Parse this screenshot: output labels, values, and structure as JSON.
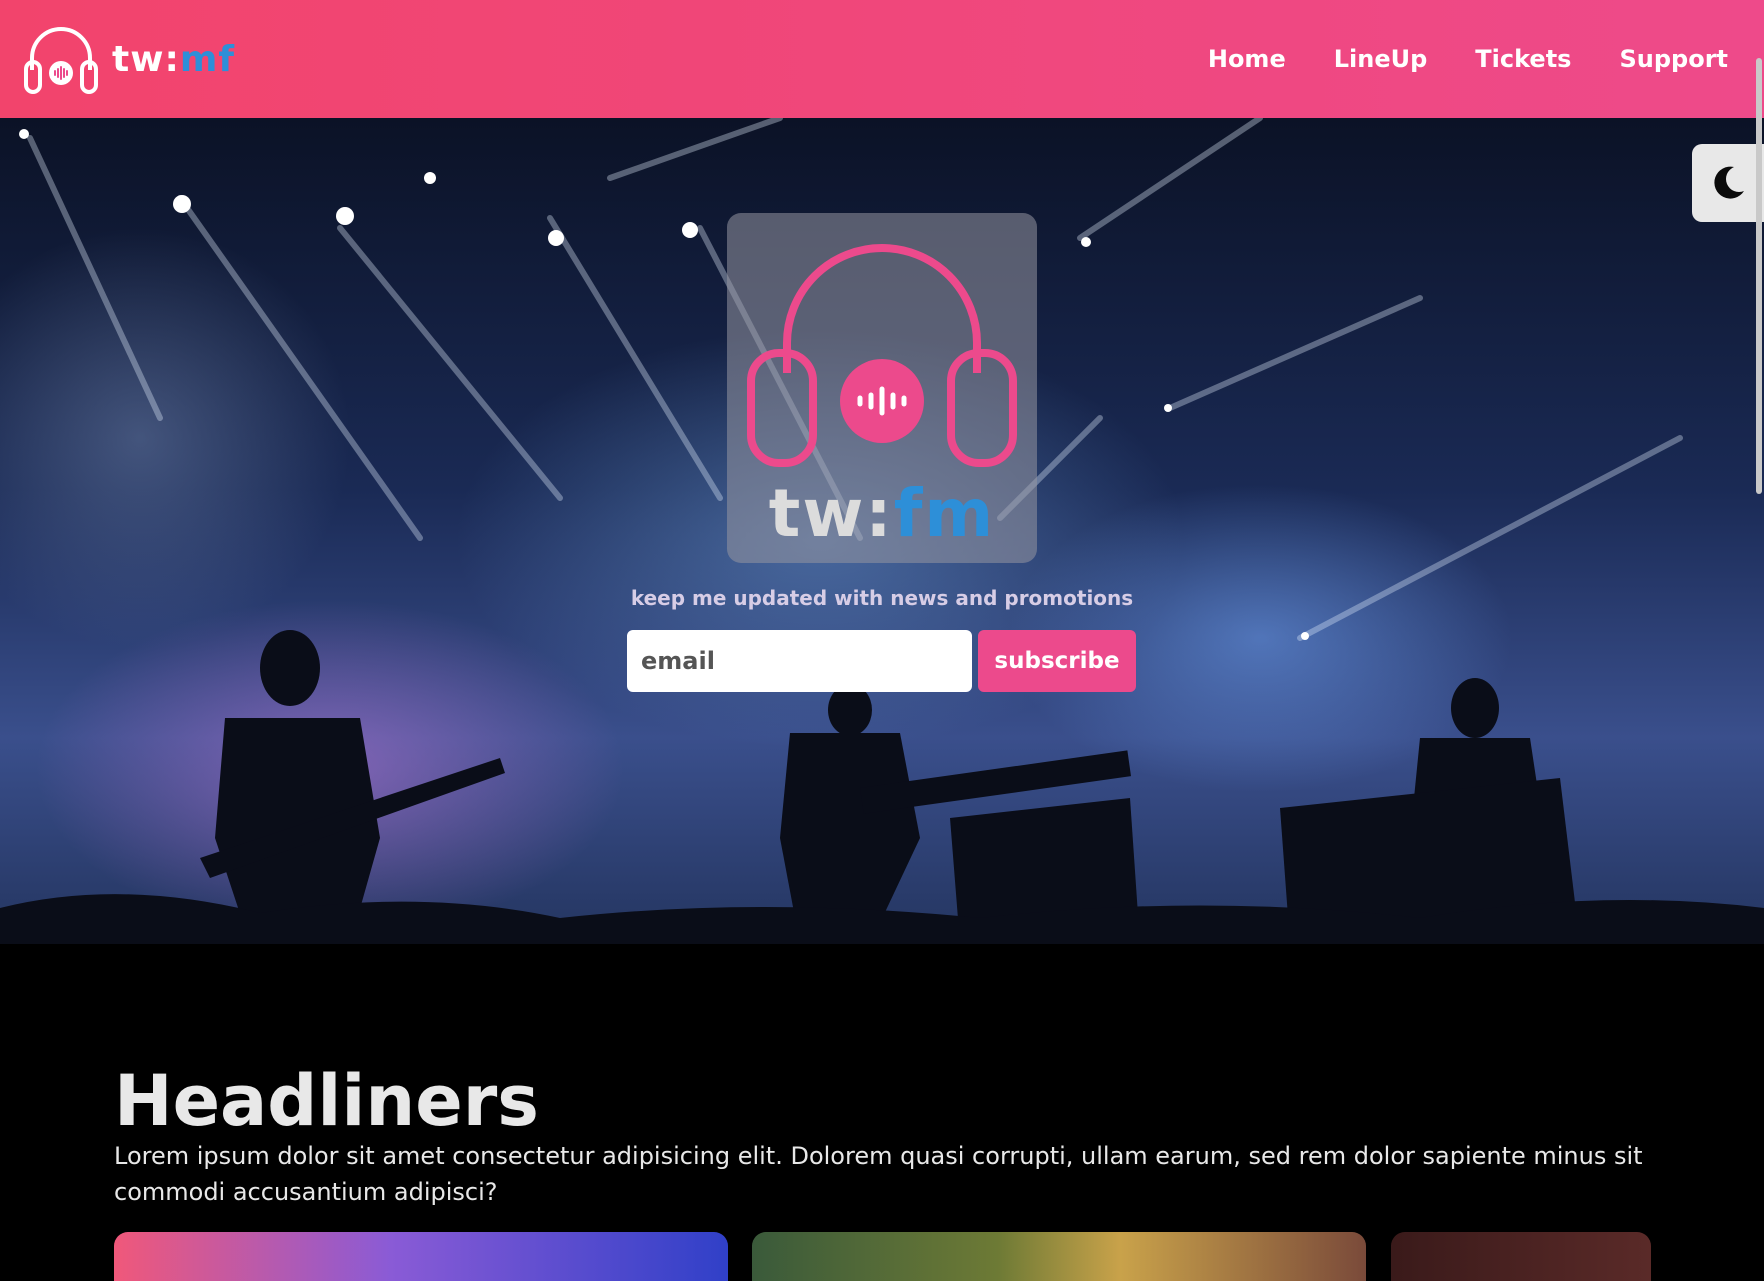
{
  "brand": {
    "text_part1": "tw:",
    "text_part2": "mf",
    "logo_icon": "headphones-icon"
  },
  "nav": {
    "items": [
      {
        "label": "Home"
      },
      {
        "label": "LineUp"
      },
      {
        "label": "Tickets"
      },
      {
        "label": "Support"
      }
    ]
  },
  "theme_toggle": {
    "icon": "moon-icon"
  },
  "hero": {
    "logo_word_part1": "tw:",
    "logo_word_part2": "fm",
    "promo_text": "keep me updated with news and promotions",
    "email_placeholder": "email",
    "subscribe_label": "subscribe"
  },
  "headliners": {
    "title": "Headliners",
    "description": "Lorem ipsum dolor sit amet consectetur adipisicing elit. Dolorem quasi corrupti, ullam earum, sed rem dolor sapiente minus sit commodi accusantium adipisci?"
  },
  "colors": {
    "navbar_start": "#f2446c",
    "navbar_end": "#ee4a8a",
    "accent_pink": "#ec4a8c",
    "accent_blue": "#2d8fd8"
  }
}
